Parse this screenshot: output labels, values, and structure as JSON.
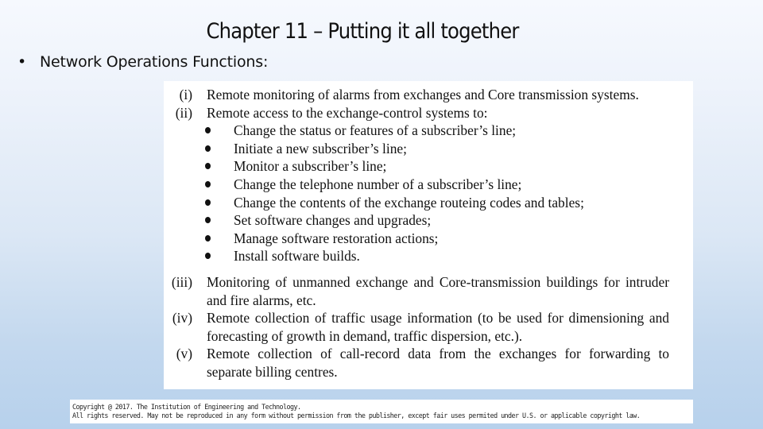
{
  "slide": {
    "title": "Chapter 11 – Putting it all together",
    "bullet": {
      "symbol": "•",
      "text": "Network Operations Functions:"
    }
  },
  "content": {
    "items": [
      {
        "num": "(i)",
        "text": "Remote monitoring of alarms from exchanges and Core transmission systems.",
        "sub_items": []
      },
      {
        "num": "(ii)",
        "text": "Remote access to the exchange-control systems to:",
        "sub_items": [
          "Change the status or features of a subscriber’s line;",
          "Initiate a new subscriber’s line;",
          "Monitor a subscriber’s line;",
          "Change the telephone number of a subscriber’s line;",
          "Change the contents of the exchange routeing codes and tables;",
          "Set software changes and upgrades;",
          "Manage software restoration actions;",
          "Install software builds."
        ]
      },
      {
        "num": "(iii)",
        "text": "Monitoring of unmanned exchange and Core-transmission buildings for intruder and fire alarms, etc.",
        "sub_items": []
      },
      {
        "num": "(iv)",
        "text": "Remote collection of traffic usage information (to be used for dimensioning and forecasting of growth in demand, traffic dispersion, etc.).",
        "sub_items": []
      },
      {
        "num": "(v)",
        "text": "Remote collection of call-record data from the exchanges for forwarding to separate billing centres.",
        "sub_items": []
      }
    ]
  },
  "copyright": {
    "line1": "Copyright @ 2017. The Institution of Engineering and Technology.",
    "line2": "All rights reserved. May not be reproduced in any form without permission from the publisher, except fair uses permited under U.S. or applicable copyright law."
  }
}
